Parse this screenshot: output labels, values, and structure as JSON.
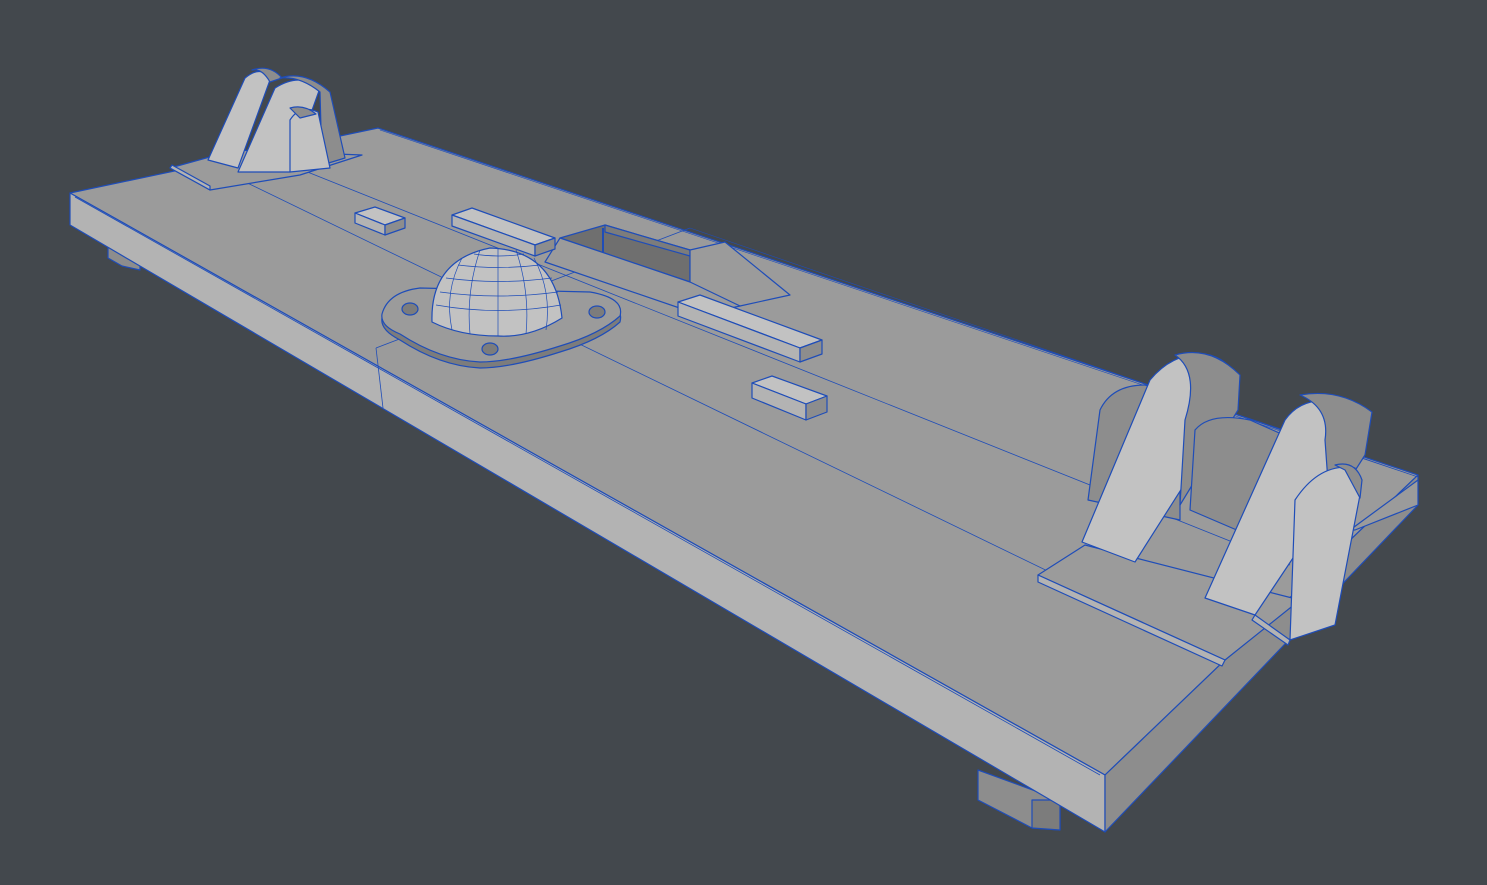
{
  "viewport": {
    "background": "#43484d",
    "mesh_fill": "#9b9b9b",
    "wireframe_color": "#1f4db8",
    "display_mode": "shaded-with-wireframe"
  },
  "model": {
    "parts": [
      "base-plate",
      "hinge-bracket-left",
      "hinge-bracket-right",
      "dome-turret",
      "turret-flange",
      "flange-rivets",
      "raised-blocks",
      "recessed-slot",
      "support-feet"
    ]
  }
}
